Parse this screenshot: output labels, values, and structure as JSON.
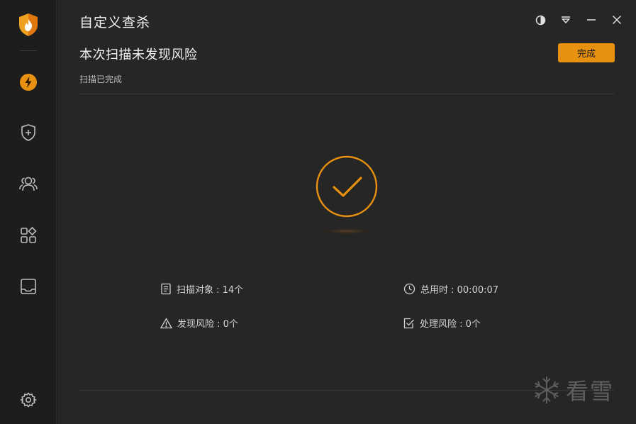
{
  "app": {
    "window_title": "自定义查杀"
  },
  "sidebar": {
    "items": [
      {
        "name": "quick-scan",
        "icon": "lightning-icon"
      },
      {
        "name": "protection",
        "icon": "shield-plus-icon"
      },
      {
        "name": "accounts",
        "icon": "users-icon"
      },
      {
        "name": "tools",
        "icon": "apps-grid-icon"
      },
      {
        "name": "box",
        "icon": "inbox-icon"
      }
    ],
    "bottom_icon": "gear-icon"
  },
  "header": {
    "headline": "本次扫描未发现风险",
    "status": "扫描已完成",
    "done_label": "完成"
  },
  "window_controls": [
    "theme-icon",
    "menu-icon",
    "minimize-icon",
    "close-icon"
  ],
  "stats": {
    "scanned_objects": "扫描对象 : 14个",
    "total_time": "总用时 : 00:00:07",
    "risks_found": "发现风险 : 0个",
    "risks_handled": "处理风险 : 0个"
  },
  "watermark": {
    "text": "看雪"
  },
  "colors": {
    "accent": "#e8900f",
    "background": "#262626",
    "sidebar": "#1d1d1d"
  }
}
